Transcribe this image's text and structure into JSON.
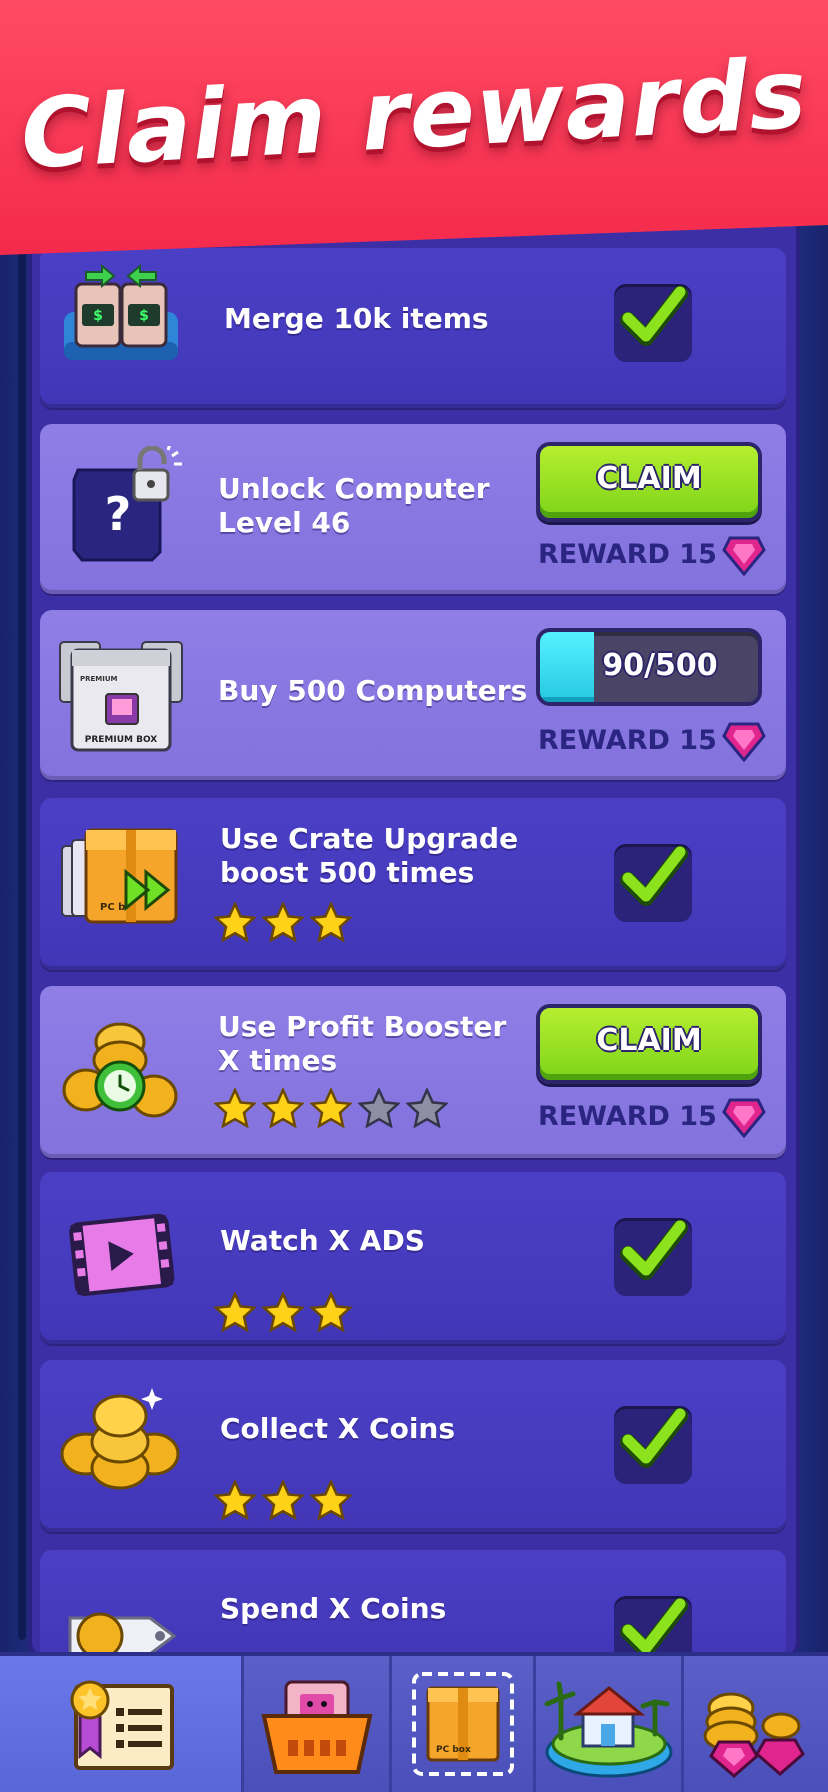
{
  "header": {
    "title": "Claim rewards"
  },
  "tasks": [
    {
      "title": "Merge 10k items",
      "state": "completed",
      "icon": "merge-computer-icon"
    },
    {
      "title": "Unlock Computer\nLevel 46",
      "state": "claimable",
      "claim_label": "CLAIM",
      "reward_label": "REWARD 15",
      "icon": "locked-computer-icon"
    },
    {
      "title": "Buy 500 Computers",
      "state": "in-progress",
      "progress_text": "90/500",
      "progress": {
        "current": 90,
        "total": 500
      },
      "reward_label": "REWARD 15",
      "icon": "premium-box-icon"
    },
    {
      "title": "Use Crate Upgrade\nboost 500 times",
      "state": "completed",
      "stars_filled": 3,
      "stars_total": 3,
      "icon": "crate-boost-icon"
    },
    {
      "title": "Use Profit Booster\nX times",
      "state": "claimable",
      "stars_filled": 3,
      "stars_total": 5,
      "claim_label": "CLAIM",
      "reward_label": "REWARD 15",
      "icon": "profit-booster-icon"
    },
    {
      "title": "Watch X ADS",
      "state": "completed",
      "stars_filled": 3,
      "stars_total": 3,
      "icon": "video-ad-icon"
    },
    {
      "title": "Collect X Coins",
      "state": "completed",
      "stars_filled": 3,
      "stars_total": 3,
      "icon": "coin-stack-icon"
    },
    {
      "title": "Spend X Coins",
      "state": "completed",
      "icon": "coin-tag-icon"
    }
  ],
  "nav": [
    {
      "icon": "quests-icon",
      "active": true
    },
    {
      "icon": "shop-basket-icon",
      "active": false
    },
    {
      "icon": "pc-box-icon",
      "active": false
    },
    {
      "icon": "island-house-icon",
      "active": false
    },
    {
      "icon": "coins-gems-icon",
      "active": false
    }
  ],
  "colors": {
    "banner": "#f42a4b",
    "row_done": "#4236b7",
    "row_active": "#8372dd",
    "claim_green": "#8fdc1f",
    "progress_cyan": "#3bd9ef",
    "gem_pink": "#e0268e",
    "star_gold": "#ffd21a"
  }
}
